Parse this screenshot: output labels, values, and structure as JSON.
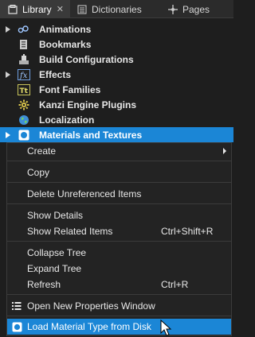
{
  "tabs": [
    {
      "label": "Library",
      "icon": "library-icon",
      "active": true
    },
    {
      "label": "Dictionaries",
      "icon": "dictionaries-icon",
      "active": false
    },
    {
      "label": "Pages",
      "icon": "pages-icon",
      "active": false
    }
  ],
  "tree": {
    "items": [
      {
        "label": "Animations",
        "icon": "animations-icon",
        "expandable": true
      },
      {
        "label": "Bookmarks",
        "icon": "bookmarks-icon",
        "expandable": false
      },
      {
        "label": "Build Configurations",
        "icon": "build-configurations-icon",
        "expandable": false
      },
      {
        "label": "Effects",
        "icon": "effects-icon",
        "icon_text": "fx",
        "expandable": true
      },
      {
        "label": "Font Families",
        "icon": "font-families-icon",
        "icon_text": "Tt",
        "expandable": false
      },
      {
        "label": "Kanzi Engine Plugins",
        "icon": "plugins-icon",
        "expandable": false
      },
      {
        "label": "Localization",
        "icon": "localization-icon",
        "expandable": false
      },
      {
        "label": "Materials and Textures",
        "icon": "materials-icon",
        "expandable": true,
        "selected": true
      }
    ]
  },
  "context_menu": {
    "create": "Create",
    "copy": "Copy",
    "delete_unreferenced": "Delete Unreferenced Items",
    "show_details": "Show Details",
    "show_related": "Show Related Items",
    "show_related_shortcut": "Ctrl+Shift+R",
    "collapse_tree": "Collapse Tree",
    "expand_tree": "Expand Tree",
    "refresh": "Refresh",
    "refresh_shortcut": "Ctrl+R",
    "open_properties": "Open New Properties Window",
    "load_material_type": "Load Material Type from Disk"
  },
  "colors": {
    "selection": "#1b86d6",
    "background": "#1e1e1e"
  }
}
